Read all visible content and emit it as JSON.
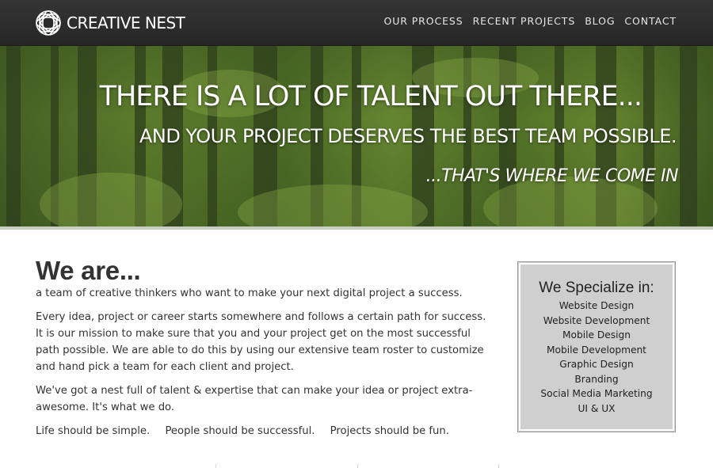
{
  "brand": {
    "name": "CREATIVE NEST",
    "logo_icon": "nest-ring-logo-icon"
  },
  "nav": {
    "items": [
      {
        "label": "OUR PROCESS"
      },
      {
        "label": "RECENT PROJECTS"
      },
      {
        "label": "BLOG"
      },
      {
        "label": "CONTACT"
      }
    ]
  },
  "hero": {
    "line1": "THERE IS A LOT OF TALENT OUT THERE...",
    "line2": "AND YOUR PROJECT DESERVES THE BEST TEAM POSSIBLE.",
    "line3": "...THAT'S WHERE WE COME IN"
  },
  "about": {
    "heading": "We are...",
    "tagline": "a team of creative thinkers who want to make your next digital project a success.",
    "paragraph1": "Every idea, project or career starts somewhere and follows a certain path for success. It is our mission to make sure that you and your project get on the most successful path possible. We are able to do this by using our extensive team roster to customize and hand pick a team for each client and project.",
    "paragraph2": "We've got a nest full of talent & expertise that can make your idea or project extra-awesome. It's what we do.",
    "motto": [
      "Life should be simple.",
      "People should be successful.",
      "Projects should be fun."
    ]
  },
  "specialize": {
    "title": "We Specialize in:",
    "items": [
      "Website Design",
      "Website Development",
      "Mobile Design",
      "Mobile Development",
      "Graphic Design",
      "Branding",
      "Social Media Marketing",
      "UI & UX"
    ]
  },
  "colors": {
    "header_bg": "#2b2b2b",
    "box_bg": "#cfcfcf",
    "text": "#333333"
  }
}
